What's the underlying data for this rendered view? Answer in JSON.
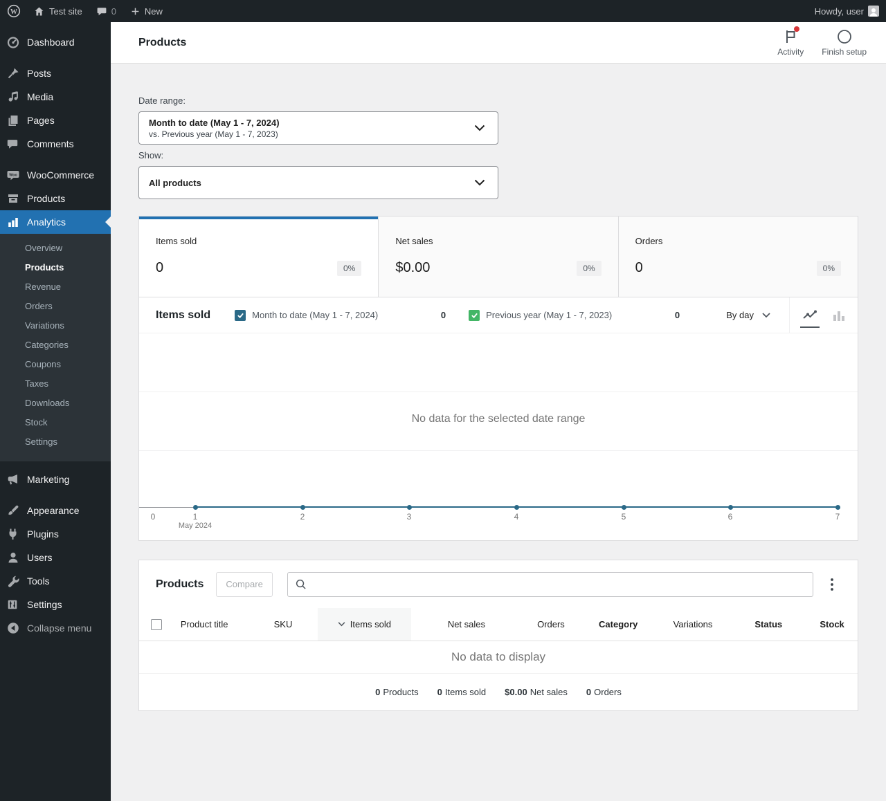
{
  "admin_bar": {
    "site_name": "Test site",
    "comments_count": "0",
    "new_label": "New",
    "howdy": "Howdy, user"
  },
  "sidebar": {
    "items": [
      {
        "label": "Dashboard"
      },
      {
        "label": "Posts"
      },
      {
        "label": "Media"
      },
      {
        "label": "Pages"
      },
      {
        "label": "Comments"
      },
      {
        "label": "WooCommerce"
      },
      {
        "label": "Products"
      },
      {
        "label": "Analytics",
        "active": true
      },
      {
        "label": "Marketing"
      },
      {
        "label": "Appearance"
      },
      {
        "label": "Plugins"
      },
      {
        "label": "Users"
      },
      {
        "label": "Tools"
      },
      {
        "label": "Settings"
      },
      {
        "label": "Collapse menu"
      }
    ],
    "analytics_submenu": [
      {
        "label": "Overview"
      },
      {
        "label": "Products",
        "active": true
      },
      {
        "label": "Revenue"
      },
      {
        "label": "Orders"
      },
      {
        "label": "Variations"
      },
      {
        "label": "Categories"
      },
      {
        "label": "Coupons"
      },
      {
        "label": "Taxes"
      },
      {
        "label": "Downloads"
      },
      {
        "label": "Stock"
      },
      {
        "label": "Settings"
      }
    ]
  },
  "header": {
    "title": "Products",
    "activity_label": "Activity",
    "finish_setup_label": "Finish setup"
  },
  "filters": {
    "date_range_label": "Date range:",
    "date_range_primary": "Month to date (May 1 - 7, 2024)",
    "date_range_secondary": "vs. Previous year (May 1 - 7, 2023)",
    "show_label": "Show:",
    "show_value": "All products"
  },
  "summary_tiles": [
    {
      "label": "Items sold",
      "value": "0",
      "delta": "0%",
      "selected": true
    },
    {
      "label": "Net sales",
      "value": "$0.00",
      "delta": "0%",
      "selected": false
    },
    {
      "label": "Orders",
      "value": "0",
      "delta": "0%",
      "selected": false
    }
  ],
  "chart": {
    "title": "Items sold",
    "legend": [
      {
        "label": "Month to date (May 1 - 7, 2024)",
        "value": "0",
        "color": "#2a6987",
        "checked": true
      },
      {
        "label": "Previous year (May 1 - 7, 2023)",
        "value": "0",
        "color": "#43b666",
        "checked": true
      }
    ],
    "interval": "By day",
    "empty_message": "No data for the selected date range",
    "x_ticks": [
      "0",
      "1",
      "2",
      "3",
      "4",
      "5",
      "6",
      "7"
    ],
    "x_axis_label": "May 2024"
  },
  "chart_data": {
    "type": "line",
    "title": "Items sold",
    "x": [
      0,
      1,
      2,
      3,
      4,
      5,
      6,
      7
    ],
    "x_axis_note": "May 2024",
    "series": [
      {
        "name": "Month to date (May 1 - 7, 2024)",
        "values": []
      },
      {
        "name": "Previous year (May 1 - 7, 2023)",
        "values": []
      }
    ],
    "empty_message": "No data for the selected date range",
    "interval": "By day",
    "legend_position": "top",
    "grid": true
  },
  "products_table": {
    "title": "Products",
    "compare_label": "Compare",
    "search_value": "",
    "columns": [
      {
        "label": "Product title"
      },
      {
        "label": "SKU"
      },
      {
        "label": "Items sold",
        "sorted": "desc"
      },
      {
        "label": "Net sales"
      },
      {
        "label": "Orders"
      },
      {
        "label": "Category"
      },
      {
        "label": "Variations"
      },
      {
        "label": "Status"
      },
      {
        "label": "Stock"
      }
    ],
    "empty_message": "No data to display",
    "summary": [
      {
        "value": "0",
        "label": "Products"
      },
      {
        "value": "0",
        "label": "Items sold"
      },
      {
        "value": "$0.00",
        "label": "Net sales"
      },
      {
        "value": "0",
        "label": "Orders"
      }
    ]
  },
  "colors": {
    "accent": "#2271b1",
    "series_primary": "#2a6987",
    "series_secondary": "#43b666",
    "notification": "#d63638"
  }
}
